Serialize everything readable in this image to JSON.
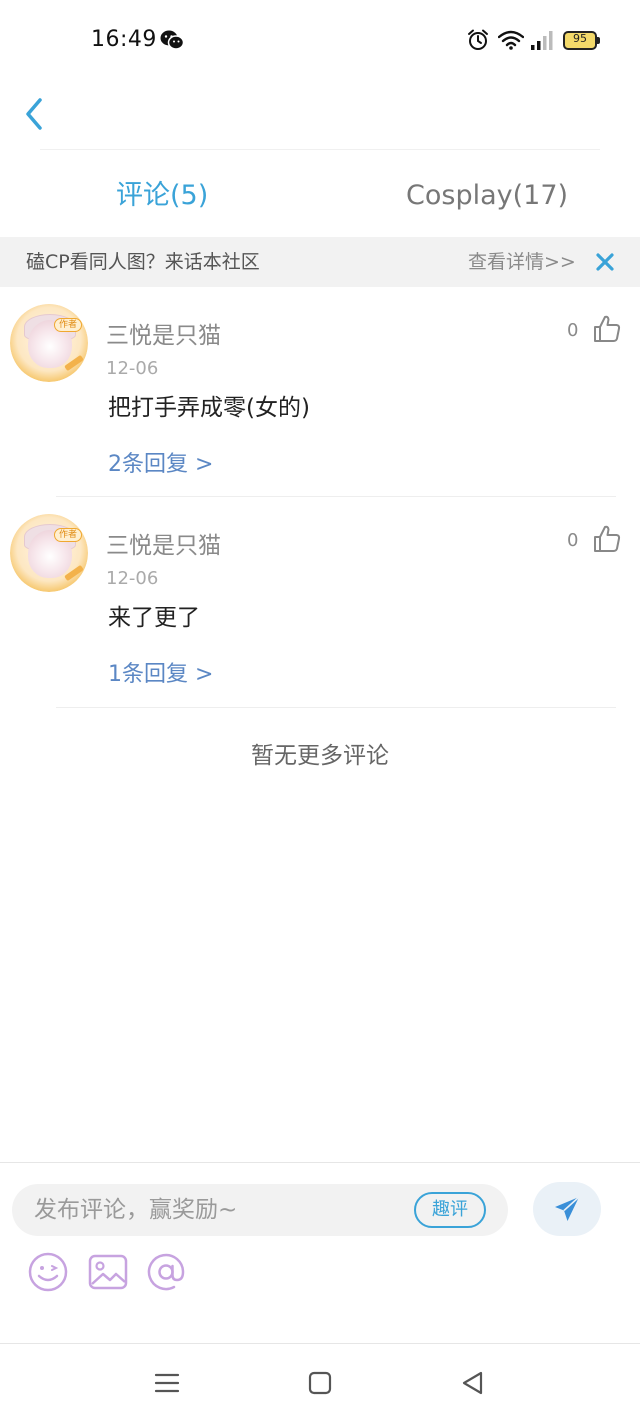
{
  "status_bar": {
    "time": "16:49",
    "battery": "95",
    "icons": [
      "wechat-icon",
      "alarm-icon",
      "wifi-icon",
      "signal-icon",
      "battery-icon"
    ]
  },
  "tabs": [
    {
      "label": "评论(5)",
      "active": true
    },
    {
      "label": "Cosplay(17)",
      "active": false
    }
  ],
  "banner": {
    "text": "磕CP看同人图？来话本社区",
    "link": "查看详情>>"
  },
  "comments": [
    {
      "username": "三悦是只猫",
      "date": "12-06",
      "text": "把打手弄成零(女的)",
      "likes": "0",
      "replies": "2条回复 >",
      "badge": "作者"
    },
    {
      "username": "三悦是只猫",
      "date": "12-06",
      "text": "来了更了",
      "likes": "0",
      "replies": "1条回复 >",
      "badge": "作者"
    }
  ],
  "no_more": "暂无更多评论",
  "composer": {
    "placeholder": "发布评论，赢奖励~",
    "quping_label": "趣评",
    "tools": [
      "emoji-icon",
      "image-icon",
      "mention-icon"
    ]
  },
  "colors": {
    "accent": "#3aa3d8",
    "reply_link": "#5b87c4",
    "tool_icon": "#c7a3e0"
  }
}
